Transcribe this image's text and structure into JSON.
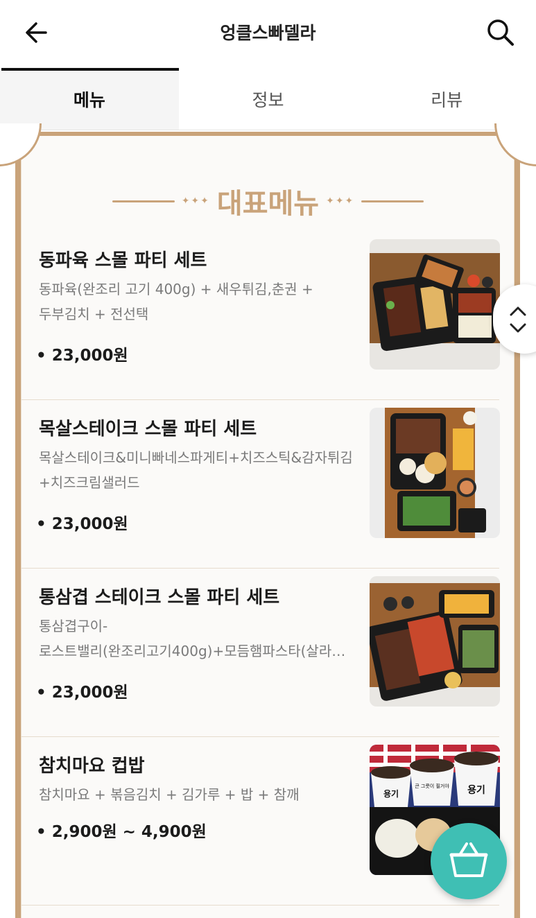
{
  "header": {
    "title": "엉클스빠델라",
    "back_icon": "back-arrow-icon",
    "search_icon": "search-icon"
  },
  "tabs": [
    {
      "label": "메뉴",
      "active": true
    },
    {
      "label": "정보",
      "active": false
    },
    {
      "label": "리뷰",
      "active": false
    }
  ],
  "section": {
    "title": "대표메뉴",
    "ornament": "✦✦✦"
  },
  "menu_items": [
    {
      "name": "동파육 스몰 파티 세트",
      "desc_line1": "동파육(완조리 고기 400g) + 새우튀김,춘권 +",
      "desc_line2": "두부김치 + 전선택",
      "price": "• 23,000원"
    },
    {
      "name": "목살스테이크 스몰 파티 세트",
      "desc_line1": "목살스테이크&미니빠네스파게티+치즈스틱&감자튀김",
      "desc_line2": "+치즈크림샐러드",
      "price": "• 23,000원"
    },
    {
      "name": "통삼겹 스테이크 스몰 파티 세트",
      "desc_line1": "통삼겹구이-",
      "desc_line2": "로스트밸리(완조리고기400g)+모듬햄파스타(살라…",
      "price": "• 23,000원"
    },
    {
      "name": "참치마요 컵밥",
      "desc_line1": "참치마요 + 볶음김치 + 김가루 + 밥 + 참깨",
      "desc_line2": "",
      "price": "• 2,900원 ~ 4,900원"
    }
  ],
  "cup_labels": [
    "용기",
    "큰 그릇이 필거야",
    "용기"
  ],
  "colors": {
    "accent_gold": "#c9a37a",
    "cart_teal": "#3fbfb4"
  },
  "floating": {
    "scroll_icon": "chevron-up-down-icon",
    "cart_icon": "shopping-basket-icon"
  }
}
